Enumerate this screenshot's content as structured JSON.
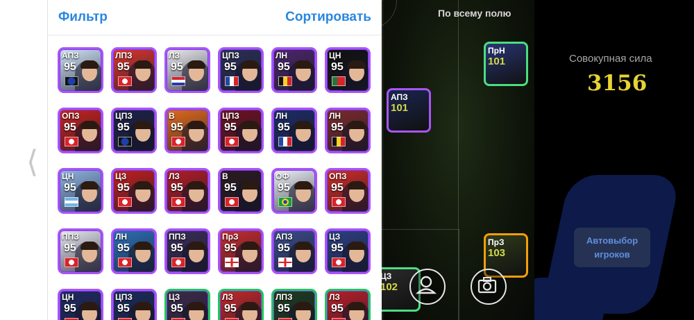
{
  "panel": {
    "filter_label": "Фильтр",
    "sort_label": "Сортировать"
  },
  "players": [
    {
      "pos": "АПЗ",
      "rating": "95",
      "bg": "#cfe3f5",
      "flag": "inter"
    },
    {
      "pos": "ЛПЗ",
      "rating": "95",
      "bg": "#d8362c",
      "flag": "club"
    },
    {
      "pos": "ЛЗ",
      "rating": "95",
      "bg": "#e9e9ec",
      "flag": "croatia"
    },
    {
      "pos": "ЦПЗ",
      "rating": "95",
      "bg": "#2a2f55",
      "flag": "france"
    },
    {
      "pos": "ЛН",
      "rating": "95",
      "bg": "#4b2668",
      "flag": "belgium"
    },
    {
      "pos": "ЦН",
      "rating": "95",
      "bg": "#111111",
      "flag": "portugal"
    },
    {
      "pos": "ОПЗ",
      "rating": "95",
      "bg": "#c8221c",
      "flag": "club"
    },
    {
      "pos": "ЦПЗ",
      "rating": "95",
      "bg": "#1d2145",
      "flag": "inter"
    },
    {
      "pos": "В",
      "rating": "95",
      "bg": "#e06a1c",
      "flag": "club"
    },
    {
      "pos": "ЦПЗ",
      "rating": "95",
      "bg": "#6f1120",
      "flag": "club"
    },
    {
      "pos": "ЛН",
      "rating": "95",
      "bg": "#1b2c63",
      "flag": "france"
    },
    {
      "pos": "ЛН",
      "rating": "95",
      "bg": "#7a2a2a",
      "flag": "belgium"
    },
    {
      "pos": "ЦН",
      "rating": "95",
      "bg": "#8fb4e0",
      "flag": "argentina"
    },
    {
      "pos": "ЦЗ",
      "rating": "95",
      "bg": "#c1201d",
      "flag": "club"
    },
    {
      "pos": "ЛЗ",
      "rating": "95",
      "bg": "#b41d24",
      "flag": "club"
    },
    {
      "pos": "В",
      "rating": "95",
      "bg": "#2a1a1e",
      "flag": "club"
    },
    {
      "pos": "ОФ",
      "rating": "95",
      "bg": "#eef1f6",
      "flag": "brazil"
    },
    {
      "pos": "ОПЗ",
      "rating": "95",
      "bg": "#d02b23",
      "flag": "club"
    },
    {
      "pos": "ППЗ",
      "rating": "95",
      "bg": "#e8e8f0",
      "flag": "club"
    },
    {
      "pos": "ЛН",
      "rating": "95",
      "bg": "#2d6fb3",
      "flag": "club"
    },
    {
      "pos": "ППЗ",
      "rating": "95",
      "bg": "#3a2d55",
      "flag": "club"
    },
    {
      "pos": "ПрЗ",
      "rating": "95",
      "bg": "#c72c2c",
      "flag": "england"
    },
    {
      "pos": "АПЗ",
      "rating": "95",
      "bg": "#3a4c88",
      "flag": "england"
    },
    {
      "pos": "ЦЗ",
      "rating": "95",
      "bg": "#2b3f80",
      "flag": "club"
    },
    {
      "pos": "ЦН",
      "rating": "95",
      "bg": "#1f2a60",
      "flag": "club"
    },
    {
      "pos": "ЦПЗ",
      "rating": "95",
      "bg": "#1b2b5a",
      "flag": "club"
    },
    {
      "pos": "ЦЗ",
      "rating": "95",
      "bg": "#3c2b4a",
      "flag": "club"
    },
    {
      "pos": "ЛЗ",
      "rating": "95",
      "bg": "#c12828",
      "flag": "club"
    },
    {
      "pos": "ЛПЗ",
      "rating": "95",
      "bg": "#1f3b1f",
      "flag": "club"
    },
    {
      "pos": "ЛЗ",
      "rating": "95",
      "bg": "#b81f26",
      "flag": "club"
    }
  ],
  "pitch": {
    "title": "По всему полю",
    "cards": [
      {
        "pos": "ПрН",
        "rating": "101",
        "bg": "#283573",
        "border": "#4ade80"
      },
      {
        "pos": "АПЗ",
        "rating": "101",
        "bg": "#1a2550",
        "border": "#a855f7"
      },
      {
        "pos": "ПрЗ",
        "rating": "103",
        "bg": "#2f3b1a",
        "border": "#f59e0b"
      },
      {
        "pos": "ЦЗ",
        "rating": "102",
        "bg": "#2a2a2a",
        "border": "#4ade80"
      }
    ]
  },
  "summary": {
    "power_label": "Совокупная сила",
    "power_value": "3156",
    "auto_line1": "Автовыбор",
    "auto_line2": "игроков"
  }
}
